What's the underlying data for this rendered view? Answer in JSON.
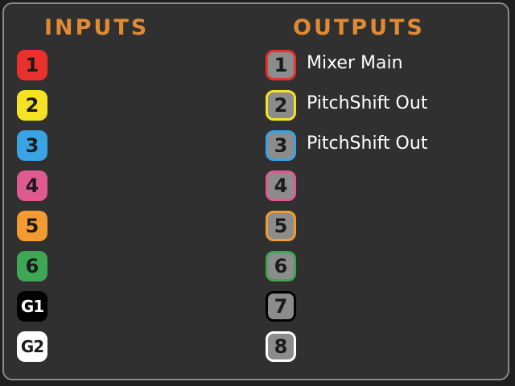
{
  "headings": {
    "inputs": "INPUTS",
    "outputs": "OUTPUTS"
  },
  "inputs": [
    {
      "label": "1",
      "color": "#e8312c",
      "text_color": "#1b1b1b"
    },
    {
      "label": "2",
      "color": "#f6e225",
      "text_color": "#1b1b1b"
    },
    {
      "label": "3",
      "color": "#3aa3e3",
      "text_color": "#1b1b1b"
    },
    {
      "label": "4",
      "color": "#e05a92",
      "text_color": "#1b1b1b"
    },
    {
      "label": "5",
      "color": "#f39a33",
      "text_color": "#1b1b1b"
    },
    {
      "label": "6",
      "color": "#3fa655",
      "text_color": "#1b1b1b"
    },
    {
      "label": "G1",
      "color": "#000000",
      "text_color": "#ffffff"
    },
    {
      "label": "G2",
      "color": "#ffffff",
      "text_color": "#1b1b1b"
    }
  ],
  "outputs": [
    {
      "label": "1",
      "border_color": "#e8312c",
      "name": "Mixer Main"
    },
    {
      "label": "2",
      "border_color": "#f6e225",
      "name": "PitchShift Out"
    },
    {
      "label": "3",
      "border_color": "#3aa3e3",
      "name": "PitchShift Out"
    },
    {
      "label": "4",
      "border_color": "#e05a92",
      "name": ""
    },
    {
      "label": "5",
      "border_color": "#f39a33",
      "name": ""
    },
    {
      "label": "6",
      "border_color": "#3fa655",
      "name": ""
    },
    {
      "label": "7",
      "border_color": "#000000",
      "name": ""
    },
    {
      "label": "8",
      "border_color": "#ffffff",
      "name": ""
    }
  ]
}
